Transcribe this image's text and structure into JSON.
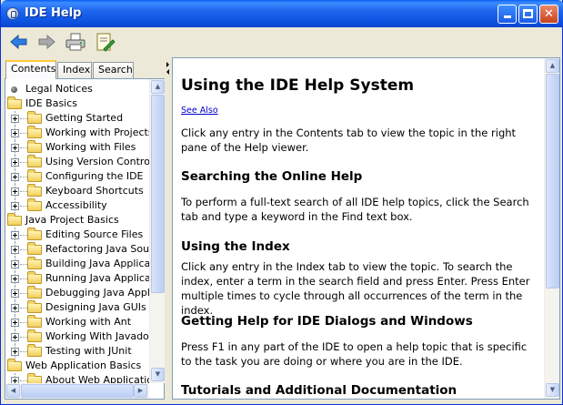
{
  "window": {
    "title": "IDE Help"
  },
  "toolbar": {
    "back": "back-arrow-icon",
    "forward": "forward-arrow-icon",
    "print": "printer-icon",
    "page_setup": "page-setup-icon"
  },
  "tabs": [
    {
      "label": "Contents",
      "active": true
    },
    {
      "label": "Index",
      "active": false
    },
    {
      "label": "Search",
      "active": false
    }
  ],
  "tree": {
    "items": [
      {
        "label": "Legal Notices",
        "level": 0,
        "type": "topic"
      },
      {
        "label": "IDE Basics",
        "level": 0,
        "type": "book"
      },
      {
        "label": "Getting Started",
        "level": 1,
        "type": "book"
      },
      {
        "label": "Working with Projects",
        "level": 1,
        "type": "book"
      },
      {
        "label": "Working with Files",
        "level": 1,
        "type": "book"
      },
      {
        "label": "Using Version Control w",
        "level": 1,
        "type": "book"
      },
      {
        "label": "Configuring the IDE",
        "level": 1,
        "type": "book"
      },
      {
        "label": "Keyboard Shortcuts",
        "level": 1,
        "type": "book"
      },
      {
        "label": "Accessibility",
        "level": 1,
        "type": "book"
      },
      {
        "label": "Java Project Basics",
        "level": 0,
        "type": "book"
      },
      {
        "label": "Editing Source Files",
        "level": 1,
        "type": "book"
      },
      {
        "label": "Refactoring Java Sourc",
        "level": 1,
        "type": "book"
      },
      {
        "label": "Building Java Applicatio",
        "level": 1,
        "type": "book"
      },
      {
        "label": "Running Java Applicati",
        "level": 1,
        "type": "book"
      },
      {
        "label": "Debugging Java Applica",
        "level": 1,
        "type": "book"
      },
      {
        "label": "Designing Java GUIs",
        "level": 1,
        "type": "book"
      },
      {
        "label": "Working with Ant",
        "level": 1,
        "type": "book"
      },
      {
        "label": "Working With Javadoc",
        "level": 1,
        "type": "book"
      },
      {
        "label": "Testing with JUnit",
        "level": 1,
        "type": "book"
      },
      {
        "label": "Web Application Basics",
        "level": 0,
        "type": "book"
      },
      {
        "label": "About Web Applications",
        "level": 1,
        "type": "book"
      }
    ]
  },
  "content": {
    "title": "Using the IDE Help System",
    "see_also": "See Also",
    "intro": "Click any entry in the Contents tab to view the topic in the right pane of the Help viewer.",
    "sections": [
      {
        "heading": "Searching the Online Help",
        "body": "To perform a full-text search of all IDE help topics, click the Search tab and type a keyword in the Find text box."
      },
      {
        "heading": "Using the Index",
        "body": "Click any entry in the Index tab to view the topic. To search the index, enter a term in the search field and press Enter. Press Enter multiple times to cycle through all occurrences of the term in the index."
      },
      {
        "heading": "Getting Help for IDE Dialogs and Windows",
        "body": "Press F1 in any part of the IDE to open a help topic that is specific to the task you are doing or where you are in the IDE."
      },
      {
        "heading": "Tutorials and Additional Documentation",
        "body": ""
      }
    ]
  },
  "colors": {
    "titlebar": "#0b52e0",
    "link": "#0000cc",
    "tab_highlight": "#ffc83c"
  }
}
